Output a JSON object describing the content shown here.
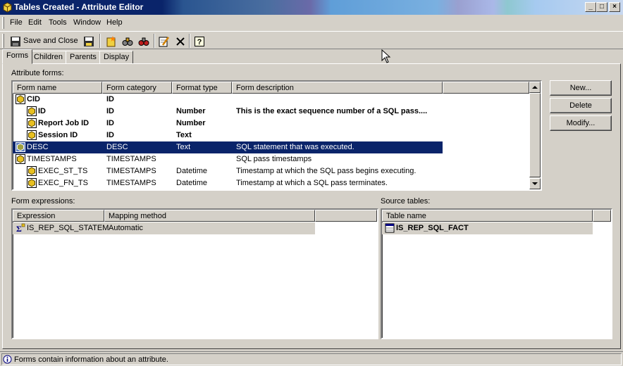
{
  "window": {
    "title": "Tables Created - Attribute Editor",
    "buttons": {
      "minimize": "_",
      "maximize": "□",
      "close": "×"
    }
  },
  "menu": [
    {
      "label": "File"
    },
    {
      "label": "Edit"
    },
    {
      "label": "Tools"
    },
    {
      "label": "Window"
    },
    {
      "label": "Help"
    }
  ],
  "toolbar": {
    "save_close_label": "Save and Close"
  },
  "tabs": [
    {
      "label": "Forms",
      "active": true
    },
    {
      "label": "Children"
    },
    {
      "label": "Parents"
    },
    {
      "label": "Display"
    }
  ],
  "attribute_forms": {
    "label": "Attribute forms:",
    "columns": [
      "Form name",
      "Form category",
      "Format type",
      "Form description"
    ],
    "rows": [
      {
        "name": "CID",
        "category": "ID",
        "format": "",
        "description": "",
        "level": 0,
        "bold": true
      },
      {
        "name": "ID",
        "category": "ID",
        "format": "Number",
        "description": "This is the exact sequence number of a SQL pass....",
        "level": 1,
        "bold": true
      },
      {
        "name": "Report Job ID",
        "category": "ID",
        "format": "Number",
        "description": "",
        "level": 1,
        "bold": true
      },
      {
        "name": "Session ID",
        "category": "ID",
        "format": "Text",
        "description": "",
        "level": 1,
        "bold": true
      },
      {
        "name": "DESC",
        "category": "DESC",
        "format": "Text",
        "description": "SQL statement that was executed.",
        "level": 0,
        "selected": true
      },
      {
        "name": "TIMESTAMPS",
        "category": "TIMESTAMPS",
        "format": "",
        "description": "SQL pass timestamps",
        "level": 0
      },
      {
        "name": "EXEC_ST_TS",
        "category": "TIMESTAMPS",
        "format": "Datetime",
        "description": "Timestamp at which the SQL pass begins executing.",
        "level": 1
      },
      {
        "name": "EXEC_FN_TS",
        "category": "TIMESTAMPS",
        "format": "Datetime",
        "description": "Timestamp at which a SQL pass terminates.",
        "level": 1
      }
    ]
  },
  "side_buttons": {
    "new": "New...",
    "delete": "Delete",
    "modify": "Modify..."
  },
  "form_expressions": {
    "label": "Form expressions:",
    "columns": [
      "Expression",
      "Mapping method"
    ],
    "rows": [
      {
        "expression": "IS_REP_SQL_STATEM",
        "mapping": "Automatic"
      }
    ]
  },
  "source_tables": {
    "label": "Source tables:",
    "columns": [
      "Table name"
    ],
    "rows": [
      {
        "name": "IS_REP_SQL_FACT"
      }
    ]
  },
  "status": {
    "text": "Forms contain information about an attribute."
  }
}
